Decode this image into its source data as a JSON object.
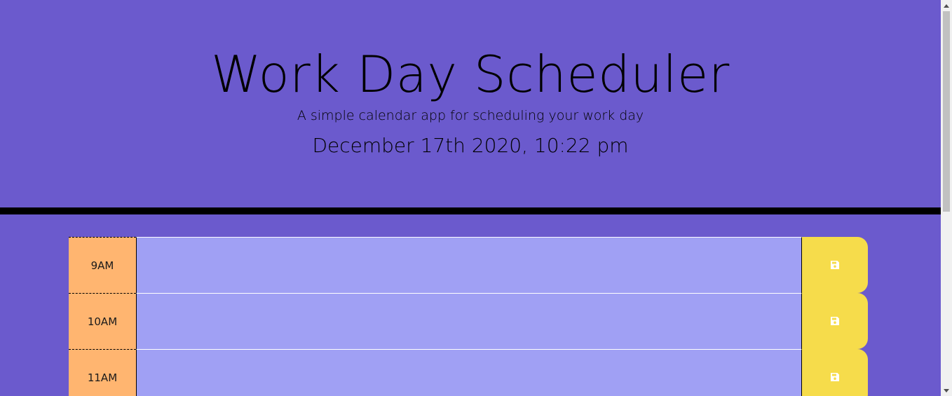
{
  "header": {
    "title": "Work Day Scheduler",
    "subtitle": "A simple calendar app for scheduling your work day",
    "current_day": "December 17th 2020, 10:22 pm"
  },
  "schedule": {
    "rows": [
      {
        "hour": "9AM",
        "description": "",
        "save_icon": "save-icon"
      },
      {
        "hour": "10AM",
        "description": "",
        "save_icon": "save-icon"
      },
      {
        "hour": "11AM",
        "description": "",
        "save_icon": "save-icon"
      }
    ]
  },
  "colors": {
    "background": "#6b5acd",
    "hour_block": "#ffb570",
    "description_past": "#a0a0f4",
    "save_button": "#f6dc4b",
    "divider": "#000000"
  }
}
